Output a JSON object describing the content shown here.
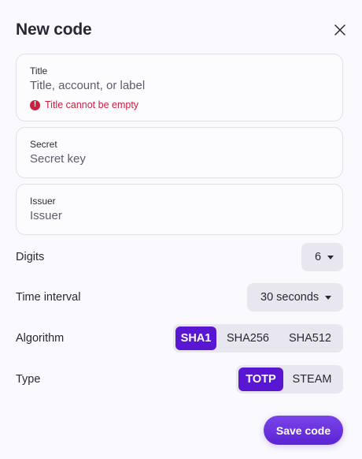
{
  "dialog": {
    "title": "New code",
    "close_icon": "close-icon"
  },
  "fields": {
    "title": {
      "label": "Title",
      "placeholder": "Title, account, or label",
      "value": "",
      "error": "Title cannot be empty",
      "error_icon": "error-icon"
    },
    "secret": {
      "label": "Secret",
      "placeholder": "Secret key",
      "value": ""
    },
    "issuer": {
      "label": "Issuer",
      "placeholder": "Issuer",
      "value": ""
    }
  },
  "settings": {
    "digits": {
      "label": "Digits",
      "value": "6"
    },
    "time_interval": {
      "label": "Time interval",
      "value": "30 seconds"
    },
    "algorithm": {
      "label": "Algorithm",
      "options": [
        "SHA1",
        "SHA256",
        "SHA512"
      ],
      "selected": "SHA1"
    },
    "type": {
      "label": "Type",
      "options": [
        "TOTP",
        "STEAM"
      ],
      "selected": "TOTP"
    }
  },
  "actions": {
    "save_label": "Save code"
  },
  "colors": {
    "accent": "#5a17d3",
    "error": "#c8223f",
    "background": "#faf9fd"
  }
}
